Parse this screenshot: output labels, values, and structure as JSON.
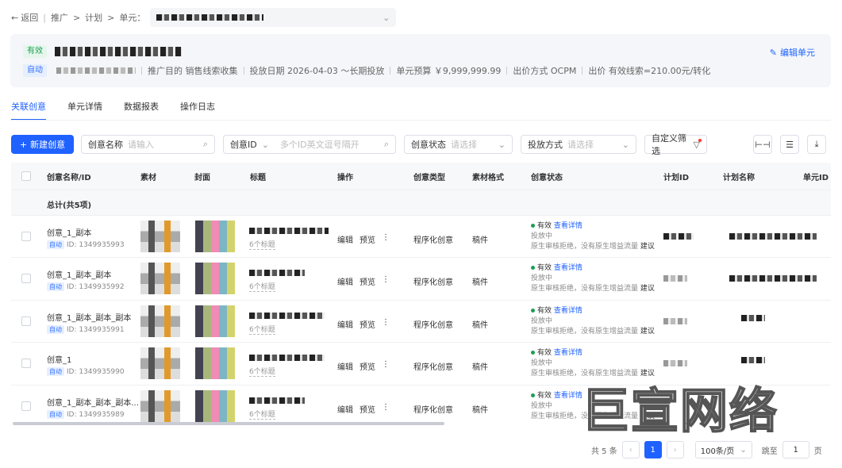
{
  "topbar": {
    "back": "返回",
    "crumbs": [
      "推广",
      "计划",
      "单元："
    ]
  },
  "unit": {
    "status_tag": "有效",
    "mode_tag": "自动",
    "purpose": "推广目的 销售线索收集",
    "date": "投放日期 2026-04-03 ～长期投放",
    "budget": "单元预算 ￥9,999,999.99",
    "bid_method": "出价方式 OCPM",
    "bid": "出价 有效线索=210.00元/转化",
    "edit_label": "编辑单元"
  },
  "tabs": [
    "关联创意",
    "单元详情",
    "数据报表",
    "操作日志"
  ],
  "toolbar": {
    "new_button": "新建创意",
    "name_label": "创意名称",
    "name_placeholder": "请输入",
    "id_label": "创意ID",
    "id_placeholder": "多个ID英文逗号隔开",
    "status_label": "创意状态",
    "status_placeholder": "请选择",
    "delivery_label": "投放方式",
    "delivery_placeholder": "请选择",
    "custom_filter": "自定义筛选"
  },
  "table": {
    "headers": [
      "创意名称/ID",
      "素材",
      "封面",
      "标题",
      "操作",
      "创意类型",
      "素材格式",
      "创意状态",
      "计划ID",
      "计划名称",
      "单元ID"
    ],
    "total_label": "总计(共5项)",
    "rows": [
      {
        "name": "创意_1_副本",
        "tag": "自动",
        "id": "ID: 1349935993",
        "title_sub": "6个标题",
        "edit": "编辑",
        "preview": "预览",
        "type": "程序化创意",
        "format": "稿件",
        "status": "有效",
        "status_link": "查看详情",
        "status_line2": "投放中",
        "status_line3": "原生审核拒绝，没有原生增益流量",
        "suggest": "建议"
      },
      {
        "name": "创意_1_副本_副本",
        "tag": "自动",
        "id": "ID: 1349935992",
        "title_sub": "6个标题",
        "edit": "编辑",
        "preview": "预览",
        "type": "程序化创意",
        "format": "稿件",
        "status": "有效",
        "status_link": "查看详情",
        "status_line2": "投放中",
        "status_line3": "原生审核拒绝，没有原生增益流量",
        "suggest": "建议"
      },
      {
        "name": "创意_1_副本_副本_副本",
        "tag": "自动",
        "id": "ID: 1349935991",
        "title_sub": "6个标题",
        "edit": "编辑",
        "preview": "预览",
        "type": "程序化创意",
        "format": "稿件",
        "status": "有效",
        "status_link": "查看详情",
        "status_line2": "投放中",
        "status_line3": "原生审核拒绝，没有原生增益流量",
        "suggest": "建议"
      },
      {
        "name": "创意_1",
        "tag": "自动",
        "id": "ID: 1349935990",
        "title_sub": "6个标题",
        "edit": "编辑",
        "preview": "预览",
        "type": "程序化创意",
        "format": "稿件",
        "status": "有效",
        "status_link": "查看详情",
        "status_line2": "投放中",
        "status_line3": "原生审核拒绝，没有原生增益流量",
        "suggest": "建议"
      },
      {
        "name": "创意_1_副本_副本_副本...",
        "tag": "自动",
        "id": "ID: 1349935989",
        "title_sub": "6个标题",
        "edit": "编辑",
        "preview": "预览",
        "type": "程序化创意",
        "format": "稿件",
        "status": "有效",
        "status_link": "查看详情",
        "status_line2": "投放中",
        "status_line3": "原生审核拒绝，没有原生增益流量",
        "suggest": "建议"
      }
    ]
  },
  "pagination": {
    "total": "共 5 条",
    "current": "1",
    "page_size": "100条/页",
    "jump_label": "跳至",
    "jump_value": "1",
    "page_unit": "页"
  },
  "watermark": "巨宣网络"
}
